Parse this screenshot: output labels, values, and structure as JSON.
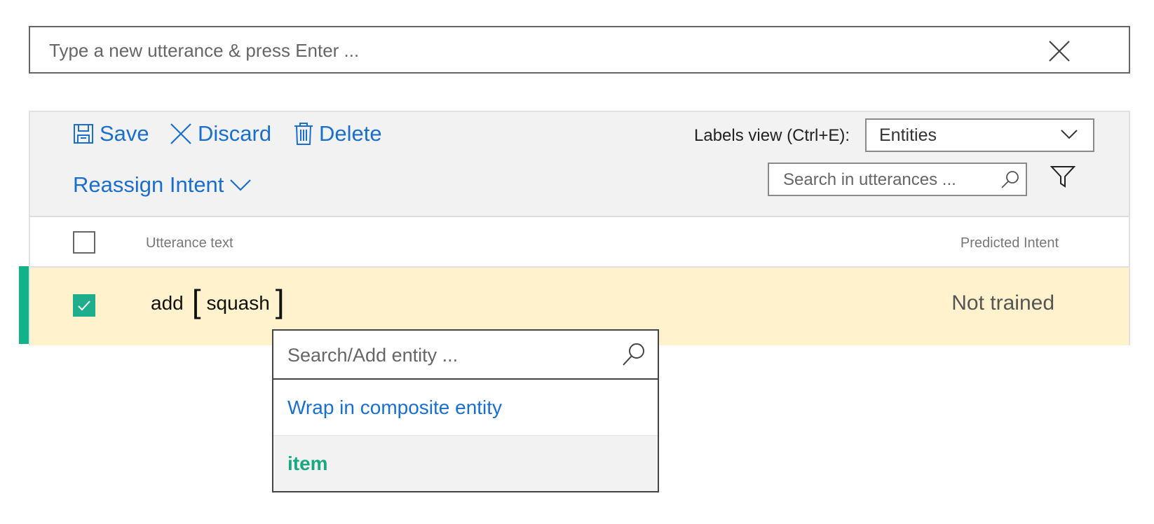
{
  "utterance_input": {
    "placeholder": "Type a new utterance & press Enter ..."
  },
  "toolbar": {
    "save_label": "Save",
    "discard_label": "Discard",
    "delete_label": "Delete",
    "reassign_label": "Reassign Intent",
    "labels_view_label": "Labels view (Ctrl+E):",
    "labels_view_value": "Entities",
    "search_placeholder": "Search in utterances ..."
  },
  "table": {
    "columns": {
      "utterance": "Utterance text",
      "predicted": "Predicted Intent"
    },
    "rows": [
      {
        "checked": true,
        "word": "add",
        "entity_text": "squash",
        "predicted_intent": "Not trained"
      }
    ]
  },
  "entity_dropdown": {
    "search_placeholder": "Search/Add entity ...",
    "wrap_label": "Wrap in composite entity",
    "items": [
      "item"
    ]
  },
  "colors": {
    "accent": "#1a6fce",
    "entity_green": "#1aa882",
    "selected_row": "#fff2cc",
    "row_marker": "#13b38a"
  },
  "icons": [
    "close-icon",
    "save-icon",
    "discard-icon",
    "trash-icon",
    "chevron-down-icon",
    "search-icon",
    "filter-icon",
    "checkmark-icon"
  ]
}
